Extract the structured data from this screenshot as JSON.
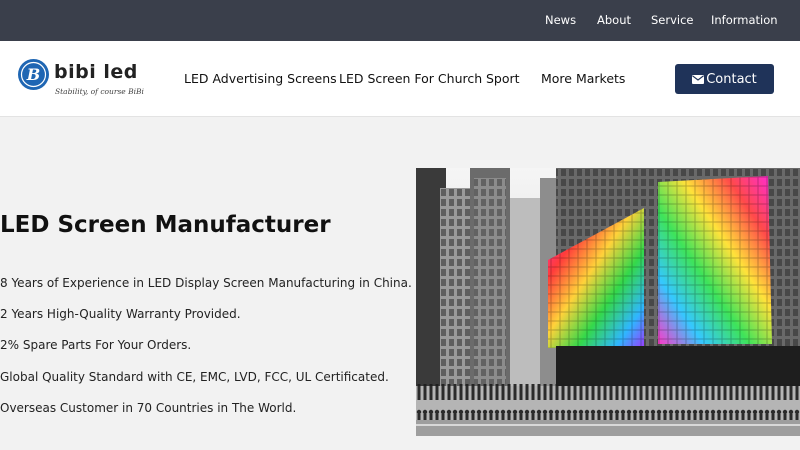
{
  "topbar": {
    "links": [
      {
        "label": "News"
      },
      {
        "label": "About"
      },
      {
        "label": "Service"
      },
      {
        "label": "Information"
      }
    ]
  },
  "header": {
    "logo": {
      "letter": "B",
      "brand": "bibi led",
      "tagline": "Stability, of course BiBi"
    },
    "nav": [
      {
        "label": "LED Advertising Screens"
      },
      {
        "label": "LED Screen For Church"
      },
      {
        "label": "Sport"
      },
      {
        "label": "More Markets"
      }
    ],
    "contact": {
      "label": "Contact",
      "icon": "envelope-icon"
    }
  },
  "hero": {
    "title": "LED Screen Manufacturer",
    "features": [
      "8 Years of Experience in LED Display Screen Manufacturing in China.",
      "2 Years High-Quality Warranty Provided.",
      "2% Spare Parts For Your Orders.",
      "Global Quality Standard with CE, EMC, LVD, FCC, UL Certificated.",
      "Overseas Customer in 70 Countries in The World."
    ]
  },
  "colors": {
    "topbar_bg": "#3a3f4b",
    "accent": "#1f3359",
    "logo_blue": "#1f66b3",
    "page_bg": "#f2f2f2"
  }
}
